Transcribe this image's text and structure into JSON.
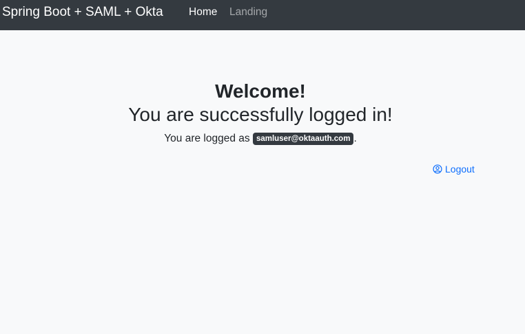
{
  "navbar": {
    "brand": "Spring Boot + SAML + Okta",
    "links": [
      {
        "label": "Home",
        "active": true
      },
      {
        "label": "Landing",
        "active": false
      }
    ]
  },
  "main": {
    "welcome": "Welcome!",
    "subtitle": "You are successfully logged in!",
    "logged_as_prefix": "You are logged as ",
    "username": "samluser@oktaauth.com",
    "logged_as_suffix": ".",
    "logout_label": "Logout",
    "logout_icon": "person-circle-icon"
  },
  "colors": {
    "navbar_bg": "#343a40",
    "page_bg": "#f8f9fa",
    "link": "#0d6efd",
    "badge_bg": "#343a40"
  }
}
